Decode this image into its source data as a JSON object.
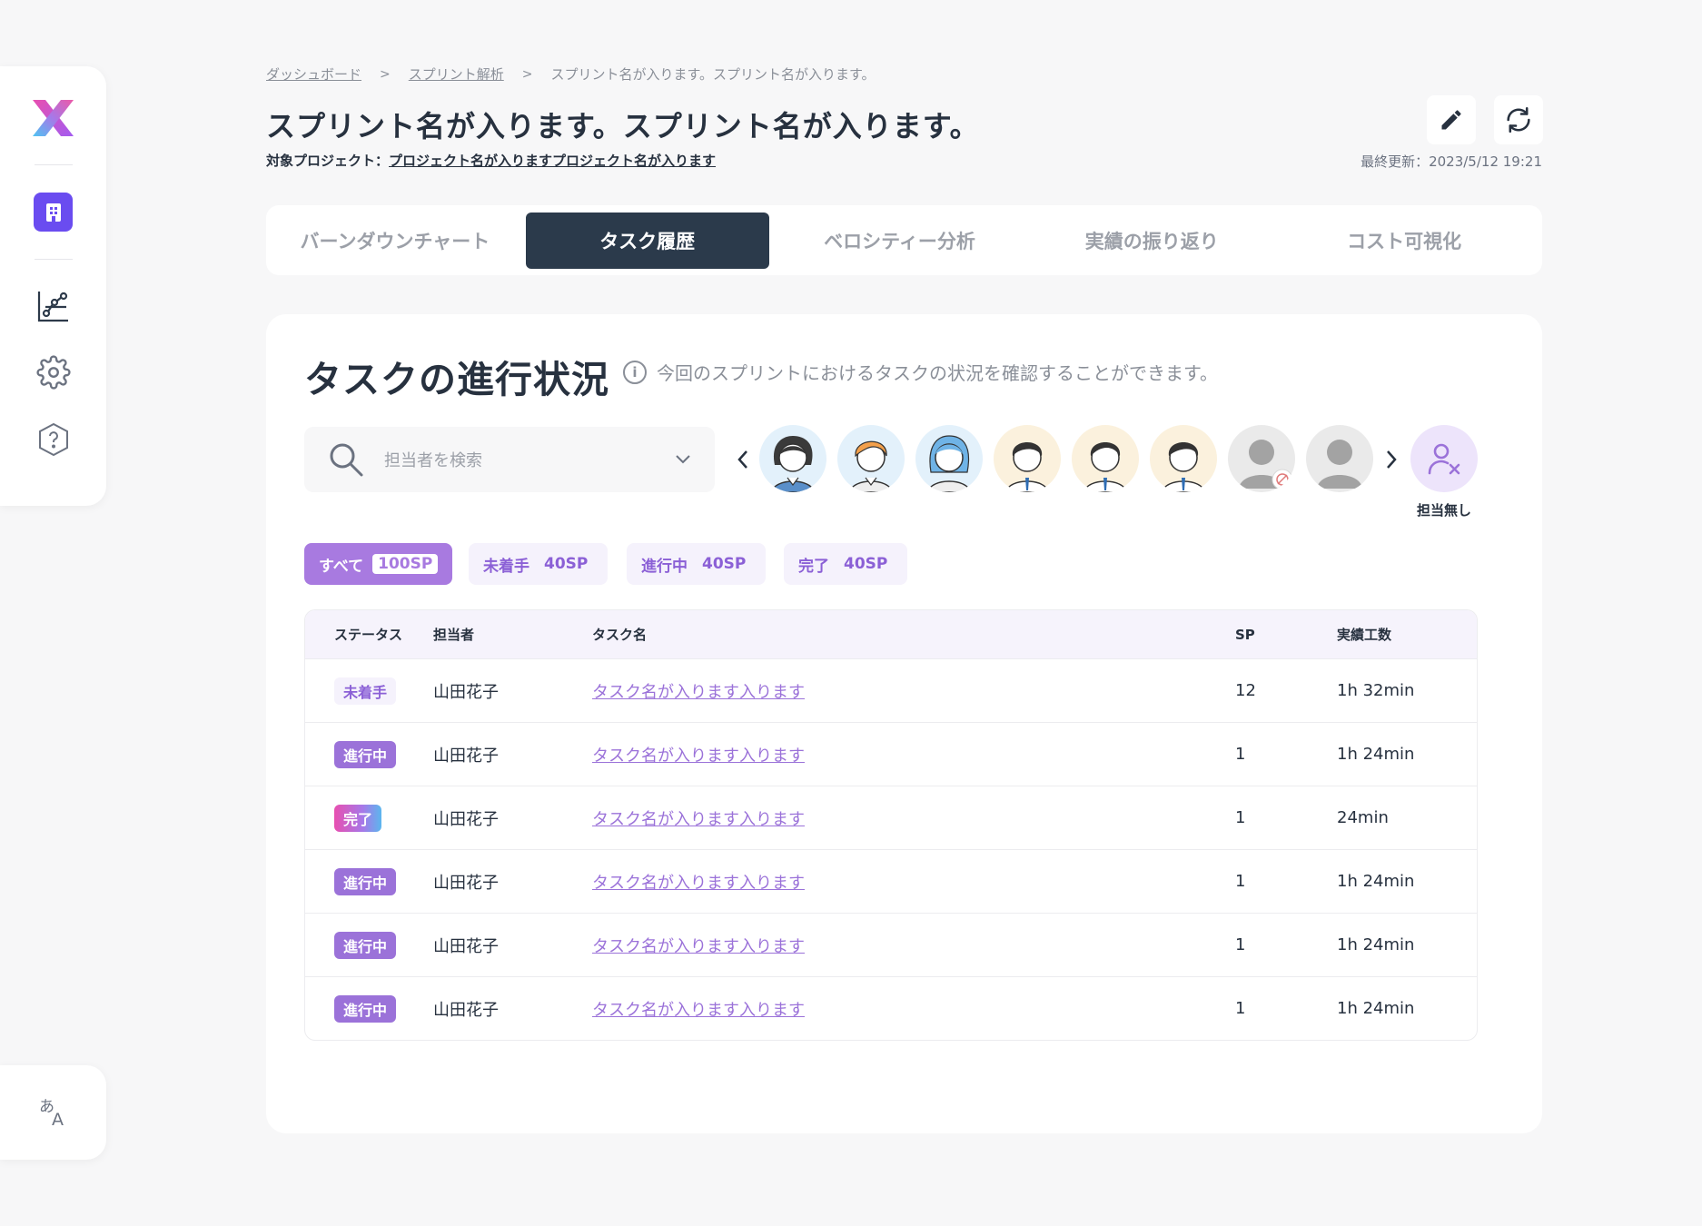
{
  "breadcrumb": {
    "items": [
      "ダッシュボード",
      "スプリント解析",
      "スプリント名が入ります。スプリント名が入ります。"
    ],
    "separator": ">"
  },
  "header": {
    "title": "スプリント名が入ります。スプリント名が入ります。",
    "project_label": "対象プロジェクト：",
    "project_name": "プロジェクト名が入りますプロジェクト名が入ります",
    "last_update": "最終更新：2023/5/12 19:21"
  },
  "tabs": [
    {
      "label": "バーンダウンチャート"
    },
    {
      "label": "タスク履歴",
      "active": true
    },
    {
      "label": "ベロシティー分析"
    },
    {
      "label": "実績の振り返り"
    },
    {
      "label": "コスト可視化"
    }
  ],
  "section": {
    "title": "タスクの進行状況",
    "info": "今回のスプリントにおけるタスクの状況を確認することができます。"
  },
  "search": {
    "placeholder": "担当者を検索"
  },
  "unassigned_label": "担当無し",
  "filters": [
    {
      "label": "すべて",
      "count": "100SP",
      "active": true
    },
    {
      "label": "未着手",
      "count": "40SP"
    },
    {
      "label": "進行中",
      "count": "40SP"
    },
    {
      "label": "完了",
      "count": "40SP"
    }
  ],
  "table": {
    "headers": {
      "status": "ステータス",
      "assignee": "担当者",
      "task": "タスク名",
      "sp": "SP",
      "effort": "実績工数"
    },
    "rows": [
      {
        "status": "未着手",
        "kind": "todo",
        "assignee": "山田花子",
        "task": "タスク名が入ります入ります",
        "sp": "12",
        "effort": "1h 32min"
      },
      {
        "status": "進行中",
        "kind": "doing",
        "assignee": "山田花子",
        "task": "タスク名が入ります入ります",
        "sp": "1",
        "effort": "1h 24min"
      },
      {
        "status": "完了",
        "kind": "done",
        "assignee": "山田花子",
        "task": "タスク名が入ります入ります",
        "sp": "1",
        "effort": "24min"
      },
      {
        "status": "進行中",
        "kind": "doing",
        "assignee": "山田花子",
        "task": "タスク名が入ります入ります",
        "sp": "1",
        "effort": "1h 24min"
      },
      {
        "status": "進行中",
        "kind": "doing",
        "assignee": "山田花子",
        "task": "タスク名が入ります入ります",
        "sp": "1",
        "effort": "1h 24min"
      },
      {
        "status": "進行中",
        "kind": "doing",
        "assignee": "山田花子",
        "task": "タスク名が入ります入ります",
        "sp": "1",
        "effort": "1h 24min"
      }
    ]
  },
  "colors": {
    "accent": "#a87ae0",
    "dark": "#2b3a4b",
    "org": "#6a4cf0"
  },
  "icons": {
    "logo": "x-logo-icon",
    "org": "building-icon",
    "analytics": "chart-icon",
    "settings": "gear-icon",
    "help": "help-icon",
    "language": "translate-icon",
    "edit": "pencil-icon",
    "refresh": "refresh-icon",
    "search": "search-icon",
    "unassigned": "user-remove-icon"
  }
}
